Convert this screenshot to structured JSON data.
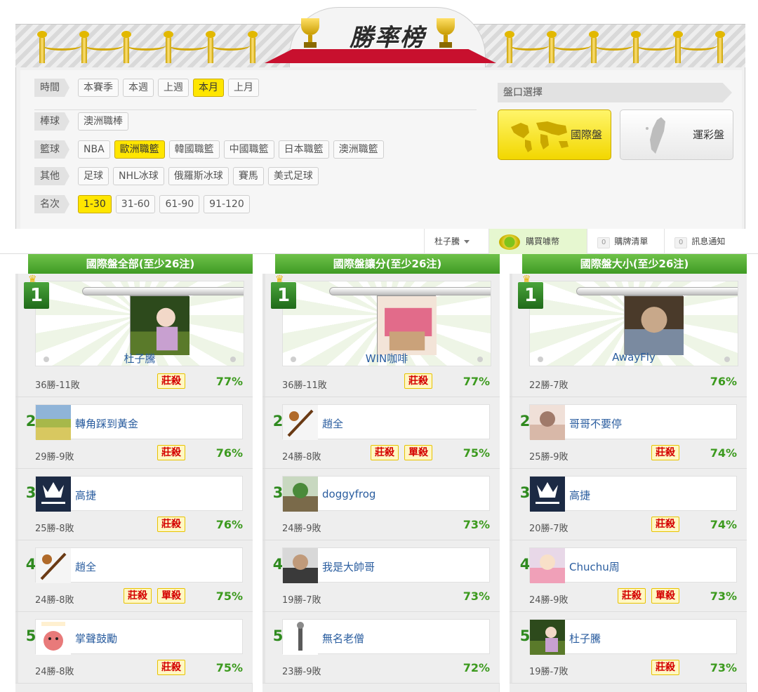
{
  "banner": {
    "title": "勝率榜"
  },
  "filters": {
    "rows": [
      {
        "label": "時間",
        "options": [
          "本賽季",
          "本週",
          "上週",
          "本月",
          "上月"
        ],
        "selected": 3
      },
      {
        "label": "棒球",
        "options": [
          "澳洲職棒"
        ],
        "selected": -1
      },
      {
        "label": "籃球",
        "options": [
          "NBA",
          "歐洲職籃",
          "韓國職籃",
          "中國職籃",
          "日本職籃",
          "澳洲職籃"
        ],
        "selected": 1
      },
      {
        "label": "其他",
        "options": [
          "足球",
          "NHL冰球",
          "俄羅斯冰球",
          "賽馬",
          "美式足球"
        ],
        "selected": -1
      },
      {
        "label": "名次",
        "options": [
          "1-30",
          "31-60",
          "61-90",
          "91-120"
        ],
        "selected": 0
      }
    ]
  },
  "market": {
    "label": "盤口選擇",
    "intl": "國際盤",
    "tw": "運彩盤",
    "selected": "intl"
  },
  "statusbar": {
    "user": "杜子騰",
    "buy": "購買噱幣",
    "buy_icon": "coin-icon",
    "purchase_count": "0",
    "purchase_list": "購牌清單",
    "message_count": "0",
    "messages": "訊息通知"
  },
  "columns": [
    {
      "header": "國際盤全部(至少26注)",
      "entries": [
        {
          "rank": "1",
          "name": "杜子騰",
          "record": "36勝-11敗",
          "tags": [
            "莊殺"
          ],
          "pct": "77%",
          "avatar": "forest-anime"
        },
        {
          "rank": "2",
          "name": "轉角踩到黃金",
          "record": "29勝-9敗",
          "tags": [
            "莊殺"
          ],
          "pct": "76%",
          "avatar": "field"
        },
        {
          "rank": "3",
          "name": "高捷",
          "record": "25勝-8敗",
          "tags": [
            "莊殺"
          ],
          "pct": "76%",
          "avatar": "maserati"
        },
        {
          "rank": "4",
          "name": "趙全",
          "record": "24勝-8敗",
          "tags": [
            "莊殺",
            "單殺"
          ],
          "pct": "75%",
          "avatar": "bat"
        },
        {
          "rank": "5",
          "name": "掌聲鼓勵",
          "record": "24勝-8敗",
          "tags": [
            "莊殺"
          ],
          "pct": "75%",
          "avatar": "clap"
        }
      ]
    },
    {
      "header": "國際盤讓分(至少26注)",
      "entries": [
        {
          "rank": "1",
          "name": "WIN咖啡",
          "record": "36勝-11敗",
          "tags": [
            "莊殺"
          ],
          "pct": "77%",
          "avatar": "money"
        },
        {
          "rank": "2",
          "name": "趙全",
          "record": "24勝-8敗",
          "tags": [
            "莊殺",
            "單殺"
          ],
          "pct": "75%",
          "avatar": "bat"
        },
        {
          "rank": "3",
          "name": "doggyfrog",
          "record": "24勝-9敗",
          "tags": [],
          "pct": "73%",
          "avatar": "frog"
        },
        {
          "rank": "4",
          "name": "我是大帥哥",
          "record": "19勝-7敗",
          "tags": [],
          "pct": "73%",
          "avatar": "person"
        },
        {
          "rank": "5",
          "name": "無名老僧",
          "record": "23勝-9敗",
          "tags": [],
          "pct": "72%",
          "avatar": "monk"
        }
      ]
    },
    {
      "header": "國際盤大小(至少26注)",
      "entries": [
        {
          "rank": "1",
          "name": "AwayFly",
          "record": "22勝-7敗",
          "tags": [],
          "pct": "76%",
          "avatar": "phone"
        },
        {
          "rank": "2",
          "name": "哥哥不要停",
          "record": "25勝-9敗",
          "tags": [
            "莊殺"
          ],
          "pct": "74%",
          "avatar": "girl"
        },
        {
          "rank": "3",
          "name": "高捷",
          "record": "20勝-7敗",
          "tags": [
            "莊殺"
          ],
          "pct": "74%",
          "avatar": "maserati"
        },
        {
          "rank": "4",
          "name": "Chuchu周",
          "record": "24勝-9敗",
          "tags": [
            "莊殺",
            "單殺"
          ],
          "pct": "73%",
          "avatar": "anime-pink"
        },
        {
          "rank": "5",
          "name": "杜子騰",
          "record": "19勝-7敗",
          "tags": [
            "莊殺"
          ],
          "pct": "73%",
          "avatar": "forest-anime"
        }
      ]
    }
  ],
  "colors": {
    "accent_green": "#3f9b24",
    "highlight_yellow": "#ffe600",
    "kill_red": "#d40000",
    "link_blue": "#2a5d9f"
  }
}
